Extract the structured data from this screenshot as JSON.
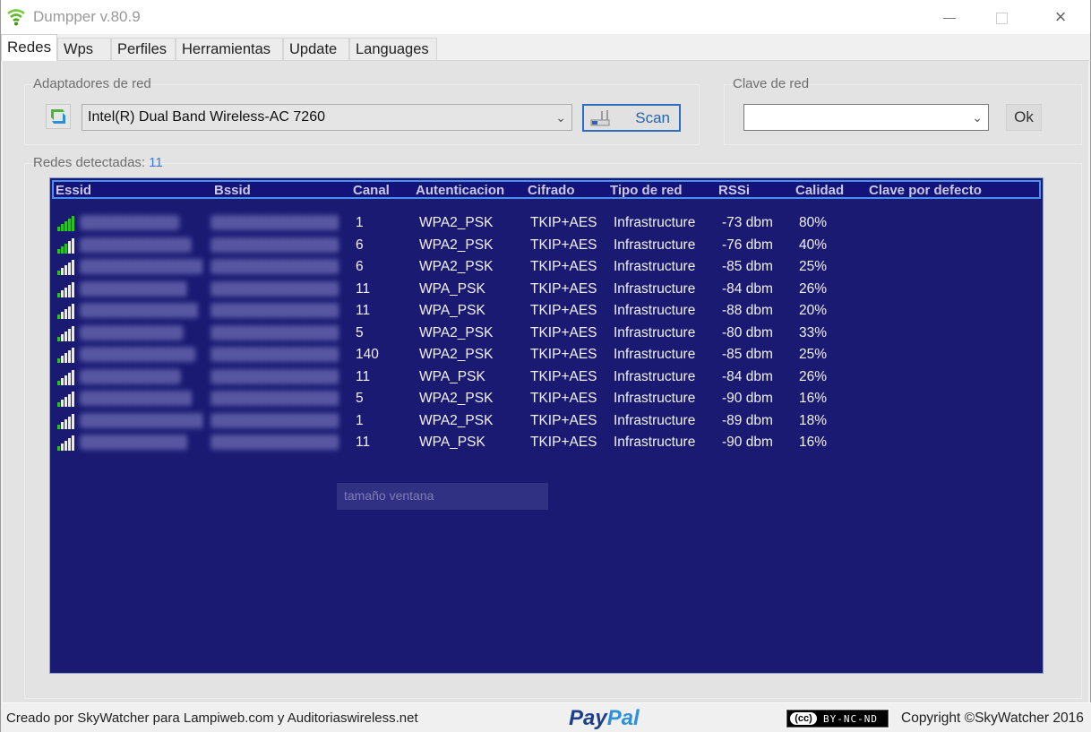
{
  "window": {
    "title": "Dumpper v.80.9",
    "icon": "wifi-icon",
    "controls": {
      "minimize": "minimize-icon",
      "maximize": "maximize-icon",
      "close": "×"
    }
  },
  "tabs": [
    {
      "label": "Redes",
      "active": true
    },
    {
      "label": "Wps",
      "active": false
    },
    {
      "label": "Perfiles",
      "active": false
    },
    {
      "label": "Herramientas",
      "active": false
    },
    {
      "label": "Update",
      "active": false
    },
    {
      "label": "Languages",
      "active": false
    }
  ],
  "adapters": {
    "label": "Adaptadores de red",
    "selected": "Intel(R) Dual Band Wireless-AC 7260",
    "chevron": "⌄",
    "scan_label": "Scan"
  },
  "network_key": {
    "label": "Clave de red",
    "value": "",
    "chevron": "⌄",
    "ok_label": "Ok"
  },
  "detected": {
    "label": "Redes detectadas:",
    "count": "11"
  },
  "table": {
    "columns": [
      "Essid",
      "Bssid",
      "Canal",
      "Autenticacion",
      "Cifrado",
      "Tipo de red",
      "RSSi",
      "Calidad",
      "Clave por defecto"
    ],
    "rows": [
      {
        "signal_bars": 5,
        "essid": "",
        "bssid": "",
        "canal": "1",
        "auth": "WPA2_PSK",
        "cifrado": "TKIP+AES",
        "tipo": "Infrastructure",
        "rssi": "-73 dbm",
        "calidad": "80%",
        "clave": ""
      },
      {
        "signal_bars": 3,
        "essid": "",
        "bssid": "",
        "canal": "6",
        "auth": "WPA2_PSK",
        "cifrado": "TKIP+AES",
        "tipo": "Infrastructure",
        "rssi": "-76 dbm",
        "calidad": "40%",
        "clave": ""
      },
      {
        "signal_bars": 1,
        "essid": "",
        "bssid": "",
        "canal": "6",
        "auth": "WPA2_PSK",
        "cifrado": "TKIP+AES",
        "tipo": "Infrastructure",
        "rssi": "-85 dbm",
        "calidad": "25%",
        "clave": ""
      },
      {
        "signal_bars": 1,
        "essid": "",
        "bssid": "",
        "canal": "11",
        "auth": "WPA_PSK",
        "cifrado": "TKIP+AES",
        "tipo": "Infrastructure",
        "rssi": "-84 dbm",
        "calidad": "26%",
        "clave": ""
      },
      {
        "signal_bars": 1,
        "essid": "",
        "bssid": "",
        "canal": "11",
        "auth": "WPA_PSK",
        "cifrado": "TKIP+AES",
        "tipo": "Infrastructure",
        "rssi": "-88 dbm",
        "calidad": "20%",
        "clave": ""
      },
      {
        "signal_bars": 1,
        "essid": "",
        "bssid": "",
        "canal": "5",
        "auth": "WPA2_PSK",
        "cifrado": "TKIP+AES",
        "tipo": "Infrastructure",
        "rssi": "-80 dbm",
        "calidad": "33%",
        "clave": ""
      },
      {
        "signal_bars": 1,
        "essid": "",
        "bssid": "",
        "canal": "140",
        "auth": "WPA2_PSK",
        "cifrado": "TKIP+AES",
        "tipo": "Infrastructure",
        "rssi": "-85 dbm",
        "calidad": "25%",
        "clave": ""
      },
      {
        "signal_bars": 1,
        "essid": "",
        "bssid": "",
        "canal": "11",
        "auth": "WPA_PSK",
        "cifrado": "TKIP+AES",
        "tipo": "Infrastructure",
        "rssi": "-84 dbm",
        "calidad": "26%",
        "clave": ""
      },
      {
        "signal_bars": 1,
        "essid": "",
        "bssid": "",
        "canal": "5",
        "auth": "WPA2_PSK",
        "cifrado": "TKIP+AES",
        "tipo": "Infrastructure",
        "rssi": "-90 dbm",
        "calidad": "16%",
        "clave": ""
      },
      {
        "signal_bars": 1,
        "essid": "",
        "bssid": "",
        "canal": "1",
        "auth": "WPA2_PSK",
        "cifrado": "TKIP+AES",
        "tipo": "Infrastructure",
        "rssi": "-89 dbm",
        "calidad": "18%",
        "clave": ""
      },
      {
        "signal_bars": 1,
        "essid": "",
        "bssid": "",
        "canal": "11",
        "auth": "WPA_PSK",
        "cifrado": "TKIP+AES",
        "tipo": "Infrastructure",
        "rssi": "-90 dbm",
        "calidad": "16%",
        "clave": ""
      }
    ],
    "tooltip_text": "tamaño ventana"
  },
  "colors": {
    "list_bg": "#1a1a73",
    "header_border": "#4b8ff0",
    "signal_on": "#27c427",
    "signal_off": "#e8e8f0"
  },
  "status": {
    "credits": "Creado por SkyWatcher para Lampiweb.com y Auditoriaswireless.net",
    "paypal_1": "Pay",
    "paypal_2": "Pal",
    "cc_icon": "(cc)",
    "license": "BY-NC-ND",
    "copyright": "Copyright ©SkyWatcher 2016"
  }
}
